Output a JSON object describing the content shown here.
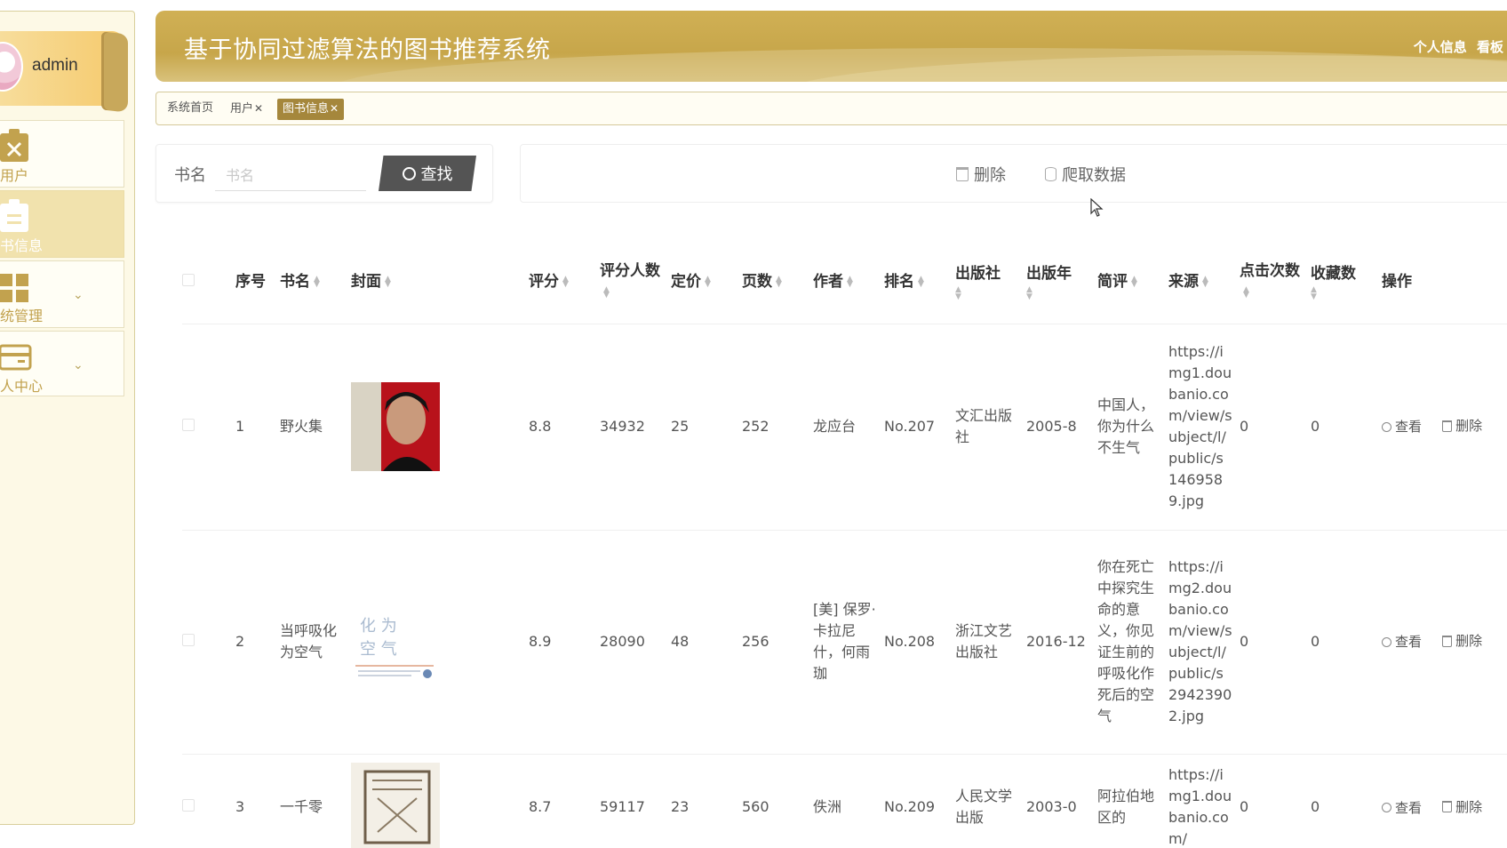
{
  "user": {
    "name": "admin"
  },
  "sidebar": {
    "items": [
      {
        "label": "用户",
        "icon": "clipboard-x-icon",
        "active": false
      },
      {
        "label": "书信息",
        "icon": "clipboard-list-icon",
        "active": true
      },
      {
        "label": "统管理",
        "icon": "grid-icon",
        "active": false,
        "expandable": true
      },
      {
        "label": "人中心",
        "icon": "id-card-icon",
        "active": false,
        "expandable": true
      }
    ]
  },
  "header": {
    "title": "基于协同过滤算法的图书推荐系统",
    "links": [
      "个人信息",
      "看板"
    ]
  },
  "tabs": [
    {
      "label": "系统首页",
      "closable": false,
      "active": false
    },
    {
      "label": "用户",
      "closable": true,
      "active": false
    },
    {
      "label": "图书信息",
      "closable": true,
      "active": true
    }
  ],
  "search": {
    "label": "书名",
    "placeholder": "书名",
    "value": "",
    "button_label": "查找"
  },
  "actions": {
    "delete_label": "删除",
    "crawl_label": "爬取数据"
  },
  "table": {
    "columns": [
      "序号",
      "书名",
      "封面",
      "评分",
      "评分人数",
      "定价",
      "页数",
      "作者",
      "排名",
      "出版社",
      "出版年",
      "简评",
      "来源",
      "点击次数",
      "收藏数",
      "操作"
    ],
    "row_actions": {
      "view": "查看",
      "delete": "删除"
    },
    "rows": [
      {
        "index": "1",
        "title": "野火集",
        "cover": "cover-wildfire",
        "rating": "8.8",
        "raters": "34932",
        "price": "25",
        "pages": "252",
        "author": "龙应台",
        "rank": "No.207",
        "publisher": "文汇出版社",
        "year": "2005-8",
        "review": "中国人，你为什么不生气",
        "source": "https://img1.doubanio.com/view/subject/l/public/s1469589.jpg",
        "clicks": "0",
        "favorites": "0"
      },
      {
        "index": "2",
        "title": "当呼吸化为空气",
        "cover": "cover-breath",
        "rating": "8.9",
        "raters": "28090",
        "price": "48",
        "pages": "256",
        "author": "[美] 保罗·卡拉尼什，何雨珈",
        "rank": "No.208",
        "publisher": "浙江文艺出版社",
        "year": "2016-12",
        "review": "你在死亡中探究生命的意义，你见证生前的呼吸化作死后的空气",
        "source": "https://img2.doubanio.com/view/subject/l/public/s29423902.jpg",
        "clicks": "0",
        "favorites": "0"
      },
      {
        "index": "3",
        "title": "一千零",
        "cover": "cover-arabian",
        "rating": "8.7",
        "raters": "59117",
        "price": "23",
        "pages": "560",
        "author": "佚洲",
        "rank": "No.209",
        "publisher": "人民文学出版",
        "year": "2003-0",
        "review": "阿拉伯地区的",
        "source": "https://img1.doubanio.com/",
        "clicks": "0",
        "favorites": "0"
      }
    ]
  },
  "colors": {
    "header": "#c9a84d",
    "sidebar_bg": "#fdf9e6",
    "accent": "#a5873c",
    "search_button": "#545454"
  }
}
